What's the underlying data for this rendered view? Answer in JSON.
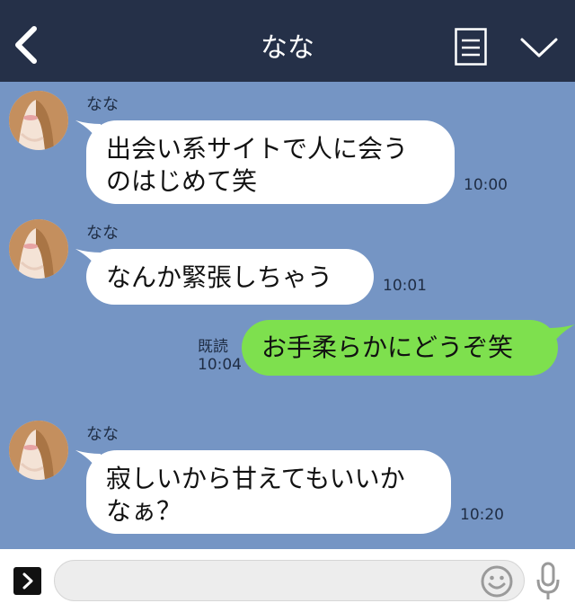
{
  "header": {
    "title": "なな"
  },
  "messages": [
    {
      "sender": "なな",
      "line1": "出会い系サイトで人に会う",
      "line2": "のはじめて笑",
      "time": "10:00"
    },
    {
      "sender": "なな",
      "text": "なんか緊張しちゃう",
      "time": "10:01"
    },
    {
      "read_label": "既読",
      "time": "10:04",
      "text": "お手柔らかにどうぞ笑"
    },
    {
      "sender": "なな",
      "line1": "寂しいから甘えてもいいか",
      "line2": "なぁ？",
      "time": "10:20"
    }
  ],
  "footer": {
    "input_placeholder": ""
  },
  "colors": {
    "header_bg": "#253048",
    "chat_bg": "#7595c4",
    "incoming": "#ffffff",
    "outgoing": "#7ee04e"
  },
  "icons": [
    "back-arrow-icon",
    "memo-icon",
    "chevron-down-icon",
    "expand-icon",
    "emoji-icon",
    "microphone-icon"
  ]
}
